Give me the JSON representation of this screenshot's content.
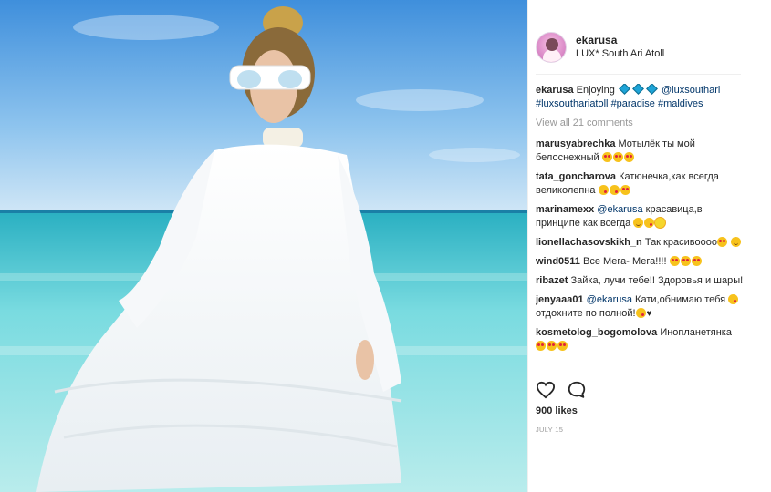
{
  "header": {
    "username": "ekarusa",
    "location": "LUX* South Ari Atoll"
  },
  "caption": {
    "username": "ekarusa",
    "text": "Enjoying",
    "mention": "@luxsouthari",
    "hashtags": [
      "#luxsouthariatoll",
      "#paradise",
      "#maldives"
    ],
    "icon": "diamond-icon"
  },
  "view_all": "View all 21 comments",
  "comments": [
    {
      "user": "marusyabrechka",
      "text": "Мотылёк ты мой белоснежный",
      "emoji": [
        "heart-eyes",
        "heart-eyes",
        "heart-eyes"
      ]
    },
    {
      "user": "tata_goncharova",
      "text": "Катюнечка,как всегда великолепна",
      "emoji": [
        "kiss",
        "kiss",
        "heart-eyes"
      ]
    },
    {
      "user": "marinamexx",
      "mention": "@ekarusa",
      "text": "красавица,в принципе как всегда",
      "emoji": [
        "smile",
        "kiss",
        "sun"
      ]
    },
    {
      "user": "lionellachasovskikh_n",
      "text": "Так красивоооо",
      "emoji": [
        "heart-eyes",
        "smile"
      ]
    },
    {
      "user": "wind0511",
      "text": "Все Мега- Мега!!!!",
      "emoji": [
        "heart-eyes",
        "heart-eyes",
        "heart-eyes"
      ]
    },
    {
      "user": "ribazet",
      "text": "Зайка, лучи тебе!! Здоровья и шары!",
      "emoji": []
    },
    {
      "user": "jenyaaa01",
      "mention": "@ekarusa",
      "text": "Кати,обнимаю тебя",
      "text2": "отдохните по полной!",
      "tail": "♥",
      "emoji": [
        "kiss"
      ],
      "emoji2": [
        "kiss"
      ]
    },
    {
      "user": "kosmetolog_bogomolova",
      "text": "Инопланетянка",
      "emoji": [
        "heart-eyes",
        "heart-eyes",
        "heart-eyes"
      ]
    }
  ],
  "actions": {
    "like_icon": "heart-icon",
    "comment_icon": "comment-icon"
  },
  "likes": "900 likes",
  "date": "JULY 15",
  "colors": {
    "link": "#003569",
    "muted": "#999999",
    "text": "#262626",
    "sea": "#4fc6d4",
    "sky": "#7db7e8"
  }
}
